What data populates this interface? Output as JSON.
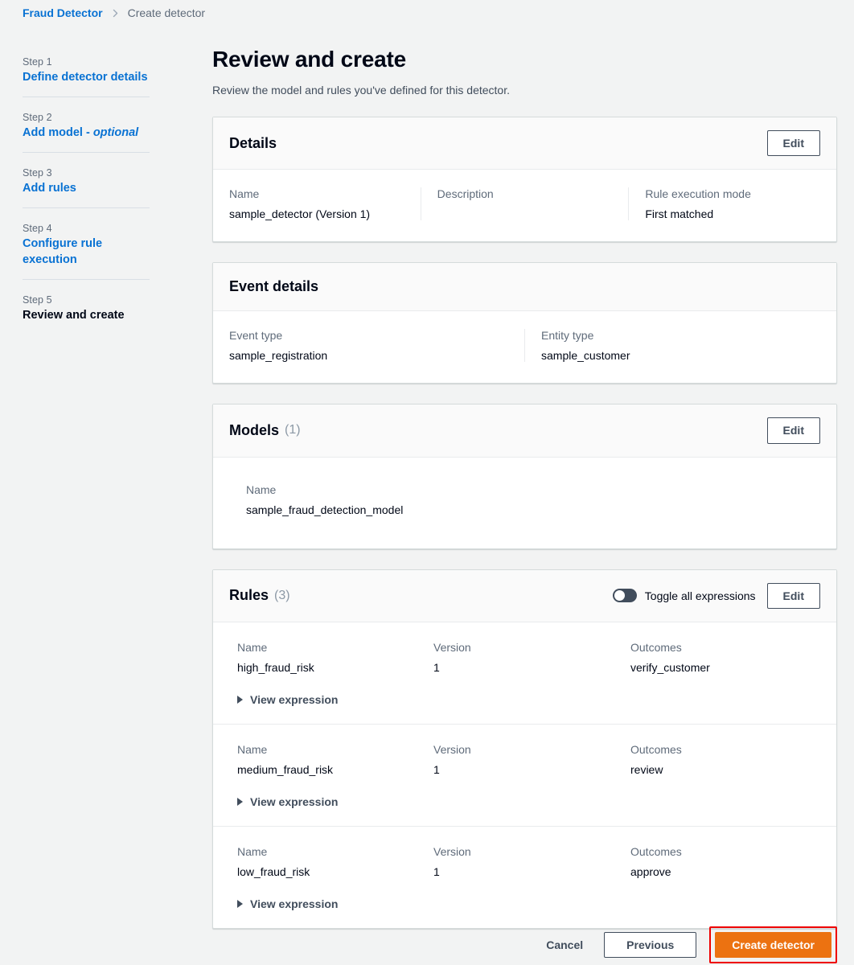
{
  "breadcrumb": {
    "root": "Fraud Detector",
    "separator_icon": "chevron-right-icon",
    "current": "Create detector"
  },
  "wizard": {
    "steps": [
      {
        "num": "Step 1",
        "title": "Define detector details",
        "optional_suffix": "",
        "current": false
      },
      {
        "num": "Step 2",
        "title": "Add model - ",
        "optional_suffix": "optional",
        "current": false
      },
      {
        "num": "Step 3",
        "title": "Add rules",
        "optional_suffix": "",
        "current": false
      },
      {
        "num": "Step 4",
        "title": "Configure rule execution",
        "optional_suffix": "",
        "current": false
      },
      {
        "num": "Step 5",
        "title": "Review and create",
        "optional_suffix": "",
        "current": true
      }
    ]
  },
  "page": {
    "title": "Review and create",
    "subtitle": "Review the model and rules you've defined for this detector."
  },
  "details_card": {
    "title": "Details",
    "edit_label": "Edit",
    "fields": [
      {
        "label": "Name",
        "value": "sample_detector (Version 1)"
      },
      {
        "label": "Description",
        "value": ""
      },
      {
        "label": "Rule execution mode",
        "value": "First matched"
      }
    ]
  },
  "event_card": {
    "title": "Event details",
    "fields": [
      {
        "label": "Event type",
        "value": "sample_registration"
      },
      {
        "label": "Entity type",
        "value": "sample_customer"
      }
    ]
  },
  "models_card": {
    "title": "Models",
    "count": "(1)",
    "edit_label": "Edit",
    "name_label": "Name",
    "models": [
      {
        "name": "sample_fraud_detection_model"
      }
    ]
  },
  "rules_card": {
    "title": "Rules",
    "count": "(3)",
    "edit_label": "Edit",
    "toggle_label": "Toggle all expressions",
    "toggle_state": "off",
    "columns": {
      "name": "Name",
      "version": "Version",
      "outcomes": "Outcomes"
    },
    "view_expression_label": "View expression",
    "rules": [
      {
        "name": "high_fraud_risk",
        "version": "1",
        "outcomes": "verify_customer"
      },
      {
        "name": "medium_fraud_risk",
        "version": "1",
        "outcomes": "review"
      },
      {
        "name": "low_fraud_risk",
        "version": "1",
        "outcomes": "approve"
      }
    ]
  },
  "footer": {
    "cancel_label": "Cancel",
    "previous_label": "Previous",
    "create_label": "Create detector"
  },
  "colors": {
    "link": "#0972d3",
    "primary_button": "#ec7211",
    "highlight_outline": "#ee0000",
    "page_background": "#f2f3f3"
  }
}
